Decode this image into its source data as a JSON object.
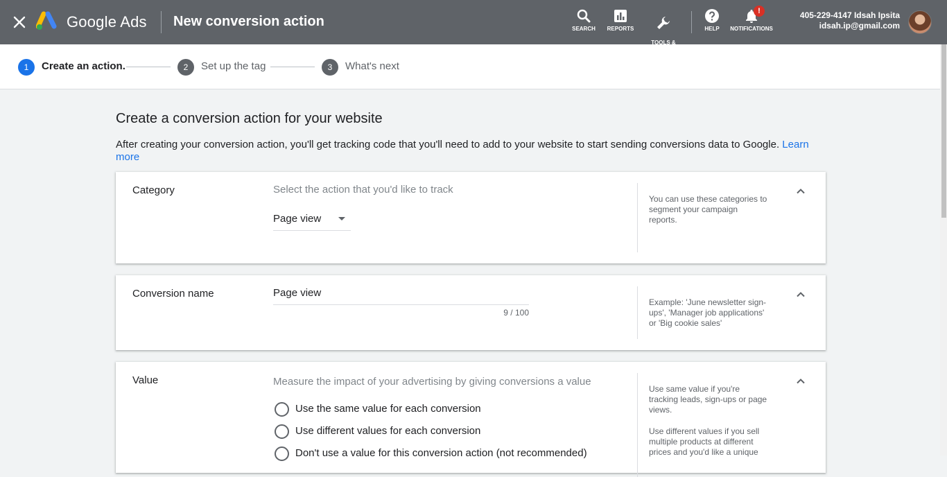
{
  "topbar": {
    "brand": "Google Ads",
    "page_title": "New conversion action",
    "tools": [
      {
        "label": "SEARCH",
        "icon": "search-icon"
      },
      {
        "label": "REPORTS",
        "icon": "reports-icon"
      },
      {
        "label": "TOOLS &\nSETTINGS",
        "icon": "wrench-icon"
      },
      {
        "label": "HELP",
        "icon": "help-icon"
      },
      {
        "label": "NOTIFICATIONS",
        "icon": "bell-icon"
      }
    ],
    "notification_badge": "!",
    "account_line1": "405-229-4147 Idsah Ipsita",
    "account_line2": "idsah.ip@gmail.com"
  },
  "stepper": {
    "steps": [
      {
        "number": "1",
        "label": "Create an action.",
        "active": true
      },
      {
        "number": "2",
        "label": "Set up the tag",
        "active": false
      },
      {
        "number": "3",
        "label": "What's next",
        "active": false
      }
    ]
  },
  "main": {
    "heading": "Create a conversion action for your website",
    "intro": "After creating your conversion action, you'll get tracking code that you'll need to add to your website to start sending conversions data to Google.",
    "learn_more": "Learn more"
  },
  "cards": {
    "category": {
      "label": "Category",
      "prompt": "Select the action that you'd like to track",
      "selected": "Page view",
      "help": "You can use these categories to segment your campaign reports."
    },
    "conversion_name": {
      "label": "Conversion name",
      "value": "Page view",
      "counter": "9 / 100",
      "help": "Example: 'June newsletter sign-ups', 'Manager job applications' or 'Big cookie sales'"
    },
    "value": {
      "label": "Value",
      "prompt": "Measure the impact of your advertising by giving conversions a value",
      "options": [
        "Use the same value for each conversion",
        "Use different values for each conversion",
        "Don't use a value for this conversion action (not recommended)"
      ],
      "help1": "Use same value if you're tracking leads, sign-ups or page views.",
      "help2": "Use different values if you sell multiple products at different prices and you'd like a unique"
    }
  },
  "colors": {
    "topbar": "#5f6368",
    "accent": "#1a73e8",
    "step_inactive": "#5f6368",
    "badge": "#d93025"
  }
}
